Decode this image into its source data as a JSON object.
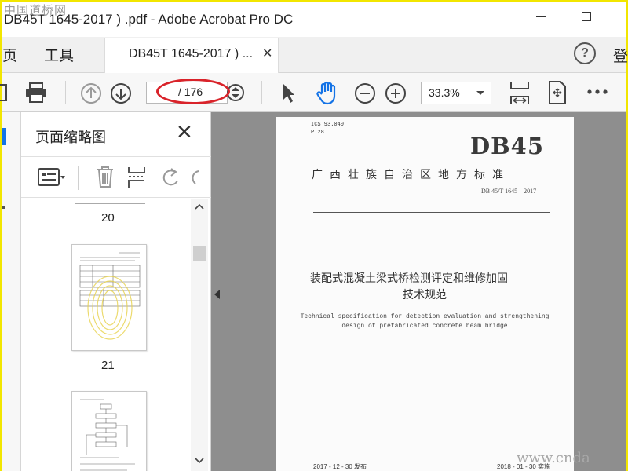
{
  "window": {
    "title": "DB45T 1645-2017 ) .pdf - Adobe Acrobat Pro DC",
    "watermark_top": "中国道桥网"
  },
  "tabs": {
    "home": "页",
    "tools": "工具",
    "document": "DB45T 1645-2017 ) ...",
    "signin": "登"
  },
  "toolbar": {
    "page_current": "",
    "page_total": "/ 176",
    "zoom": "33.3%"
  },
  "icons": [
    "save-icon",
    "print-icon",
    "page-up-icon",
    "page-down-icon",
    "page-stepper-icon",
    "select-arrow-icon",
    "hand-tool-icon",
    "zoom-out-icon",
    "zoom-in-icon",
    "fit-page-icon",
    "full-screen-icon",
    "more-icon",
    "help-icon",
    "close-icon",
    "options-icon",
    "delete-icon",
    "insert-page-icon",
    "rotate-icon",
    "thumbnails-icon"
  ],
  "colors": {
    "accent": "#1473e6",
    "annotation": "#d9232a",
    "frame": "#f2e600"
  },
  "thumbnails": {
    "title": "页面缩略图",
    "pages": [
      "20",
      "21"
    ]
  },
  "document_page": {
    "ics": "ICS 93.040",
    "p": "P 28",
    "code": "DB45",
    "standard_name": "广西壮族自治区地方标准",
    "standard_number": "DB 45/T 1645—2017",
    "title_line1": "装配式混凝土梁式桥检测评定和维修加固",
    "title_line2": "技术规范",
    "en_line1": "Technical specification for detection evaluation and strengthening",
    "en_line2": "design of prefabricated concrete beam bridge",
    "issue_date": "2017 - 12 - 30 发布",
    "impl_date": "2018 - 01 - 30 实施",
    "watermark_bottom": "www.cnda"
  }
}
